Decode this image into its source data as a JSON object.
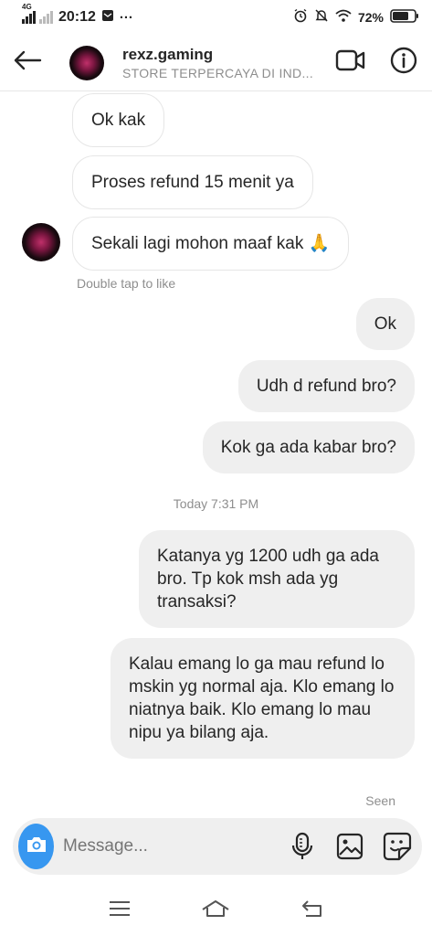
{
  "status_bar": {
    "network": "4G",
    "time": "20:12",
    "more": "···",
    "battery": "72%"
  },
  "header": {
    "name": "rexz.gaming",
    "subtitle": "STORE TERPERCAYA DI IND..."
  },
  "messages": [
    {
      "text": "Ok kak",
      "from": "them"
    },
    {
      "text": "Proses refund 15 menit ya",
      "from": "them"
    },
    {
      "text": "Sekali lagi mohon maaf kak 🙏",
      "from": "them"
    },
    {
      "text": "Ok",
      "from": "me"
    },
    {
      "text": "Udh d refund bro?",
      "from": "me"
    },
    {
      "text": "Kok ga ada kabar bro?",
      "from": "me"
    },
    {
      "text": "Katanya yg 1200 udh ga ada bro. Tp kok msh ada yg transaksi?",
      "from": "me"
    },
    {
      "text": "Kalau emang lo ga mau refund lo mskin yg normal aja. Klo emang lo niatnya baik. Klo emang lo mau nipu ya bilang aja.",
      "from": "me"
    }
  ],
  "hints": {
    "double_tap": "Double tap to like",
    "timestamp": "Today 7:31 PM",
    "seen": "Seen"
  },
  "composer": {
    "placeholder": "Message..."
  },
  "icons": {
    "back": "arrow-left-icon",
    "video": "video-camera-icon",
    "info": "info-icon",
    "camera": "camera-icon",
    "mic": "microphone-icon",
    "gallery": "image-icon",
    "sticker": "sticker-icon"
  },
  "colors": {
    "accent": "#3797f0",
    "incoming_border": "#e6e6e6",
    "outgoing_bg": "#efefef",
    "muted_text": "#8e8e8e"
  }
}
